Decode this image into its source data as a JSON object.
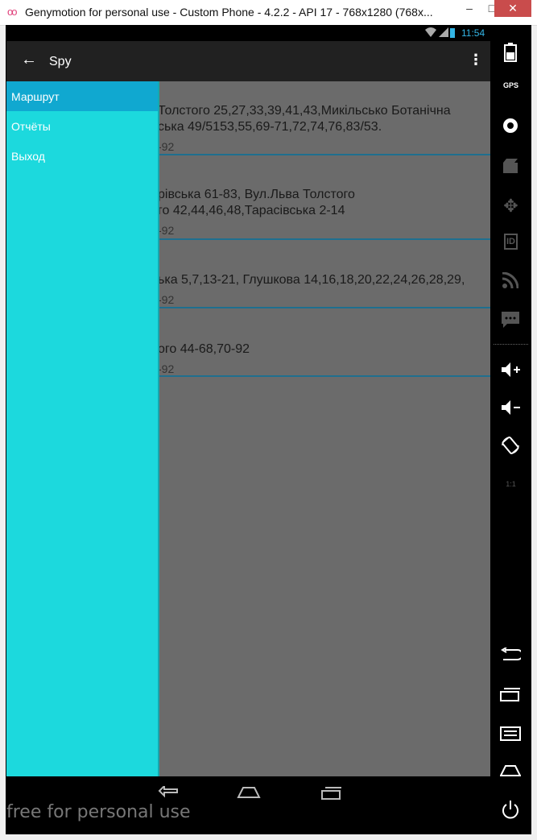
{
  "window": {
    "title": "Genymotion for personal use - Custom Phone - 4.2.2 - API 17 - 768x1280 (768x...",
    "minimize_label": "–",
    "maximize_label": "□",
    "close_label": "✕"
  },
  "statusbar": {
    "time": "11:54"
  },
  "actionbar": {
    "back_glyph": "←",
    "title": "Spy",
    "menu_glyph": "⋮"
  },
  "list": {
    "rows": [
      {
        "line1": "Толстого 25,27,33,39,41,43,Микільсько Ботанічна",
        "line2": "ська 49/5153,55,69-71,72,74,76,83/53.",
        "sub": "-92"
      },
      {
        "line1": "рівська 61-83, Вул.Льва Толстого",
        "line2": "го 42,44,46,48,Тарасівська 2-14",
        "sub": "-92"
      },
      {
        "line1": "ька 5,7,13-21, Глушкова 14,16,18,20,22,24,26,28,29,",
        "line2": "",
        "sub": "-92"
      },
      {
        "line1": "ого 44-68,70-92",
        "line2": "",
        "sub": "-92"
      }
    ]
  },
  "drawer": {
    "items": [
      {
        "label": "Маршрут",
        "active": true
      },
      {
        "label": "Отчёты",
        "active": false
      },
      {
        "label": "Выход",
        "active": false
      }
    ]
  },
  "watermark": "free for personal use",
  "sidebar": {
    "gps_label": "GPS",
    "id_label": "ID",
    "pixel_label": "1:1"
  },
  "colors": {
    "drawer_bg": "#1cd9dd",
    "drawer_active": "#10a8d0",
    "actionbar": "#212121",
    "accent_time": "#33b5e5",
    "divider": "#1f6f8f"
  }
}
